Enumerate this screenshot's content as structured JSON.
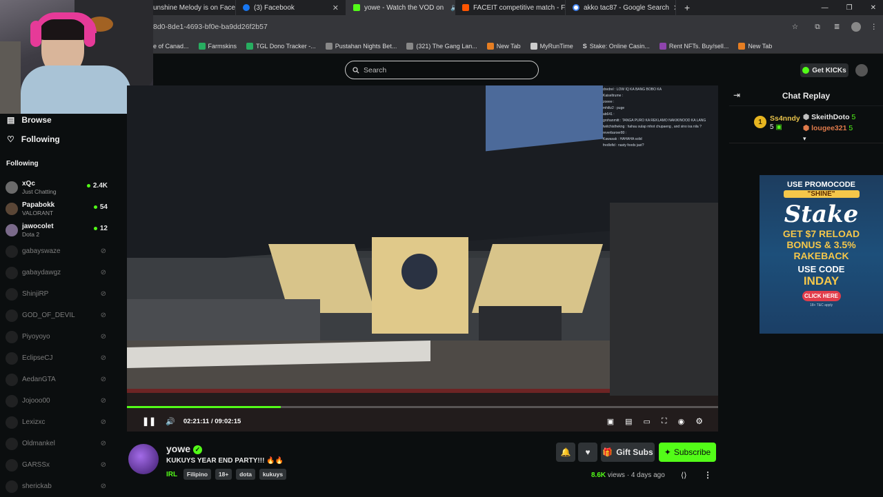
{
  "tabs": [
    {
      "label": "unshine Melody is on Face",
      "icon": "kick",
      "color": "#53fc18"
    },
    {
      "label": "(3) Facebook",
      "icon": "facebook",
      "color": "#1877f2"
    },
    {
      "label": "yowe - Watch the VOD on",
      "icon": "kick",
      "color": "#53fc18",
      "active": true
    },
    {
      "label": "FACEIT competitive match - FA",
      "icon": "faceit",
      "color": "#ff5500"
    },
    {
      "label": "akko tac87 - Google Search",
      "icon": "google",
      "color": "#4285f4"
    }
  ],
  "address": "8d0-8de1-4693-bf0e-ba9dd26f2b57",
  "bookmarks": [
    {
      "label": "e of Canad...",
      "color": "#c0392b"
    },
    {
      "label": "Farmskins",
      "color": "#27ae60"
    },
    {
      "label": "TGL Dono Tracker -...",
      "color": "#27ae60"
    },
    {
      "label": "Pustahan Nights Bet...",
      "color": "#888888"
    },
    {
      "label": "(321) The Gang Lan...",
      "color": "#888888"
    },
    {
      "label": "New Tab",
      "color": "#e67e22"
    },
    {
      "label": "MyRunTime",
      "color": "#cccccc"
    },
    {
      "label": "Stake: Online Casin...",
      "color": "#cccccc"
    },
    {
      "label": "Rent NFTs. Buy/sell...",
      "color": "#8e44ad"
    },
    {
      "label": "New Tab",
      "color": "#e67e22"
    }
  ],
  "header": {
    "search_placeholder": "Search",
    "get_kicks": "Get KICKs"
  },
  "sidebar": {
    "browse": "Browse",
    "following": "Following",
    "following_heading": "Following",
    "channels": [
      {
        "name": "xQc",
        "sub": "Just Chatting",
        "viewers": "2.4K",
        "live": true
      },
      {
        "name": "Papabokk",
        "sub": "VALORANT",
        "viewers": "54",
        "live": true
      },
      {
        "name": "jawocolet",
        "sub": "Dota 2",
        "viewers": "12",
        "live": true
      },
      {
        "name": "gabayswaze",
        "live": false
      },
      {
        "name": "gabaydawgz",
        "live": false
      },
      {
        "name": "ShinjiRP",
        "live": false
      },
      {
        "name": "GOD_OF_DEVIL",
        "live": false
      },
      {
        "name": "Piyoyoyo",
        "live": false
      },
      {
        "name": "EclipseCJ",
        "live": false
      },
      {
        "name": "AedanGTA",
        "live": false
      },
      {
        "name": "Jojooo00",
        "live": false
      },
      {
        "name": "Lexizxc",
        "live": false
      },
      {
        "name": "Oldmankel",
        "live": false
      },
      {
        "name": "GARSSx",
        "live": false
      },
      {
        "name": "sherickab",
        "live": false
      }
    ]
  },
  "player": {
    "time": "02:21:11 / 09:02:15",
    "progress": 0.26
  },
  "chat": {
    "title": "Chat Replay",
    "leaders": [
      {
        "rank": "1",
        "name": "Ss4nndy",
        "count": "5"
      },
      {
        "name": "SkeithDoto",
        "count": "5"
      },
      {
        "name": "lougee321",
        "count": "5"
      }
    ],
    "overlay_lines": [
      "dredrel : LOW IQ KA BANG BOBO KA",
      "Kaiseltrume :",
      "zoeee :",
      "mhiltz2 : puge",
      "ab641 :",
      "grohanmitt : TANGA PURO KA REKLAMO NAKIKINOOD KA LANG",
      "twitchisthekng : hahau sulap mhot chupaeng , and sino isa nila ?",
      "reverbaroer80 :",
      "Kawasak : HAHAHA solid",
      "fredlofid : nasty foods jast?"
    ]
  },
  "ad": {
    "top": "USE PROMOCODE",
    "code": "\"SHINE\"",
    "brand": "Stake",
    "line1": "GET $7 RELOAD",
    "line2": "BONUS & 3.5%",
    "line3": "RAKEBACK",
    "line4": "USE CODE",
    "line5": "INDAY",
    "cta": "CLICK HERE",
    "fine": "18+ T&C apply"
  },
  "stream": {
    "streamer": "yowe",
    "title": "KUKUYS YEAR END PARTY!!! 🔥🔥",
    "category": "IRL",
    "tags": [
      "Filipino",
      "18+",
      "dota",
      "kukuys"
    ],
    "views": "8.6K",
    "views_label": "views",
    "age": "4 days ago",
    "gift_label": "Gift Subs",
    "subscribe_label": "Subscribe"
  },
  "colors": {
    "accent": "#53fc18",
    "bg": "#0b0e0f"
  }
}
